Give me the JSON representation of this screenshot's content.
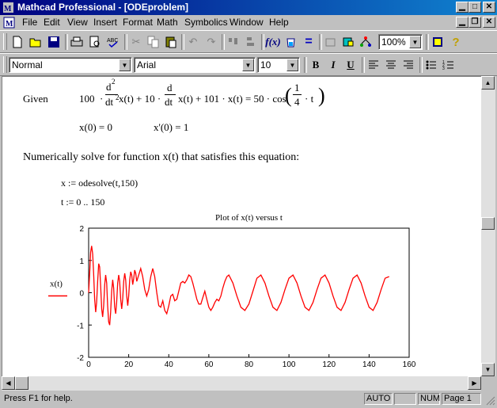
{
  "window": {
    "title": "Mathcad Professional - [ODEproblem]"
  },
  "menu": [
    "File",
    "Edit",
    "View",
    "Insert",
    "Format",
    "Math",
    "Symbolics",
    "Window",
    "Help"
  ],
  "toolbar": {
    "zoom": "100%"
  },
  "formatbar": {
    "style": "Normal",
    "font": "Arial",
    "size": "10"
  },
  "doc": {
    "given_label": "Given",
    "eq_c1": "100",
    "eq_d2": "d",
    "eq_sq": "2",
    "eq_dt2": "dt",
    "eq_x1": "x(t) + 10 ·",
    "eq_d": "d",
    "eq_dt": "dt",
    "eq_x2": "x(t) + 101 · x(t) = 50 · cos",
    "eq_num": "1",
    "eq_den": "4",
    "eq_t": "· t",
    "ic1": "x(0) = 0",
    "ic2": "x'(0) = 1",
    "instruction": "Numerically solve for function x(t) that satisfies this equation:",
    "solve": "x := odesolve(t,150)",
    "range": "t := 0 .. 150"
  },
  "status": {
    "help": "Press F1 for help.",
    "auto": "AUTO",
    "num": "NUM",
    "page": "Page 1"
  },
  "chart_data": {
    "type": "line",
    "title": "Plot of x(t) versus t",
    "xlabel": "",
    "ylabel": "x(t)",
    "xlim": [
      0,
      160
    ],
    "ylim": [
      -2,
      2
    ],
    "xticks": [
      "0",
      "20",
      "40",
      "60",
      "80",
      "100",
      "120",
      "140",
      "160"
    ],
    "yticks": [
      "2",
      "1",
      "0",
      "-1",
      "-2"
    ],
    "color": "#ff0000",
    "series": [
      {
        "name": "x(t)",
        "x": [
          0,
          0.5,
          1,
          1.5,
          2,
          2.5,
          3,
          3.5,
          4,
          4.5,
          5,
          5.5,
          6,
          6.5,
          7,
          7.5,
          8,
          8.5,
          9,
          9.5,
          10,
          10.5,
          11,
          11.5,
          12,
          12.5,
          13,
          13.5,
          14,
          14.5,
          15,
          15.5,
          16,
          16.5,
          17,
          17.5,
          18,
          18.5,
          19,
          19.5,
          20,
          20.5,
          21,
          21.5,
          22,
          22.5,
          23,
          23.5,
          24,
          25,
          26,
          27,
          28,
          29,
          30,
          31,
          32,
          33,
          34,
          35,
          36,
          37,
          38,
          39,
          40,
          41,
          42,
          43,
          44,
          45,
          46,
          47,
          48,
          49,
          50,
          51,
          52,
          53,
          54,
          55,
          56,
          57,
          58,
          59,
          60,
          61,
          62,
          63,
          64,
          65,
          66,
          67,
          68,
          69,
          70,
          72,
          74,
          76,
          78,
          80,
          82,
          84,
          86,
          88,
          90,
          92,
          94,
          96,
          98,
          100,
          102,
          104,
          106,
          108,
          110,
          112,
          114,
          116,
          118,
          120,
          122,
          124,
          126,
          128,
          130,
          132,
          134,
          136,
          138,
          140,
          142,
          144,
          146,
          148,
          150
        ],
        "values": [
          0,
          0.6,
          1.25,
          1.45,
          1.2,
          0.6,
          -0.2,
          -0.6,
          -0.3,
          0.35,
          0.9,
          0.8,
          0.2,
          -0.5,
          -0.75,
          -0.4,
          0.25,
          0.55,
          0.3,
          -0.4,
          -0.9,
          -1.0,
          -0.6,
          0.05,
          0.4,
          0.15,
          -0.45,
          -0.65,
          -0.3,
          0.3,
          0.55,
          0.35,
          -0.2,
          -0.5,
          -0.2,
          0.35,
          0.6,
          0.4,
          -0.1,
          -0.4,
          -0.1,
          0.4,
          0.65,
          0.55,
          0.25,
          0.45,
          0.7,
          0.6,
          0.35,
          0.55,
          0.75,
          0.5,
          0.1,
          -0.1,
          0.1,
          0.5,
          0.75,
          0.5,
          0,
          -0.4,
          -0.45,
          -0.25,
          -0.55,
          -0.65,
          -0.4,
          -0.1,
          -0.05,
          -0.25,
          -0.2,
          0.05,
          0.3,
          0.35,
          0.3,
          0.4,
          0.55,
          0.5,
          0.3,
          0.05,
          -0.2,
          -0.35,
          -0.35,
          -0.15,
          0.05,
          -0.2,
          -0.45,
          -0.55,
          -0.45,
          -0.3,
          -0.2,
          -0.25,
          -0.1,
          0.15,
          0.35,
          0.5,
          0.55,
          0.3,
          -0.1,
          -0.45,
          -0.55,
          -0.35,
          0.05,
          0.45,
          0.55,
          0.3,
          -0.1,
          -0.45,
          -0.55,
          -0.3,
          0.1,
          0.45,
          0.55,
          0.3,
          -0.1,
          -0.45,
          -0.55,
          -0.3,
          0.1,
          0.45,
          0.55,
          0.3,
          -0.1,
          -0.45,
          -0.55,
          -0.3,
          0.1,
          0.45,
          0.55,
          0.3,
          -0.1,
          -0.45,
          -0.55,
          -0.3,
          0.1,
          0.45,
          0.5
        ]
      }
    ]
  }
}
